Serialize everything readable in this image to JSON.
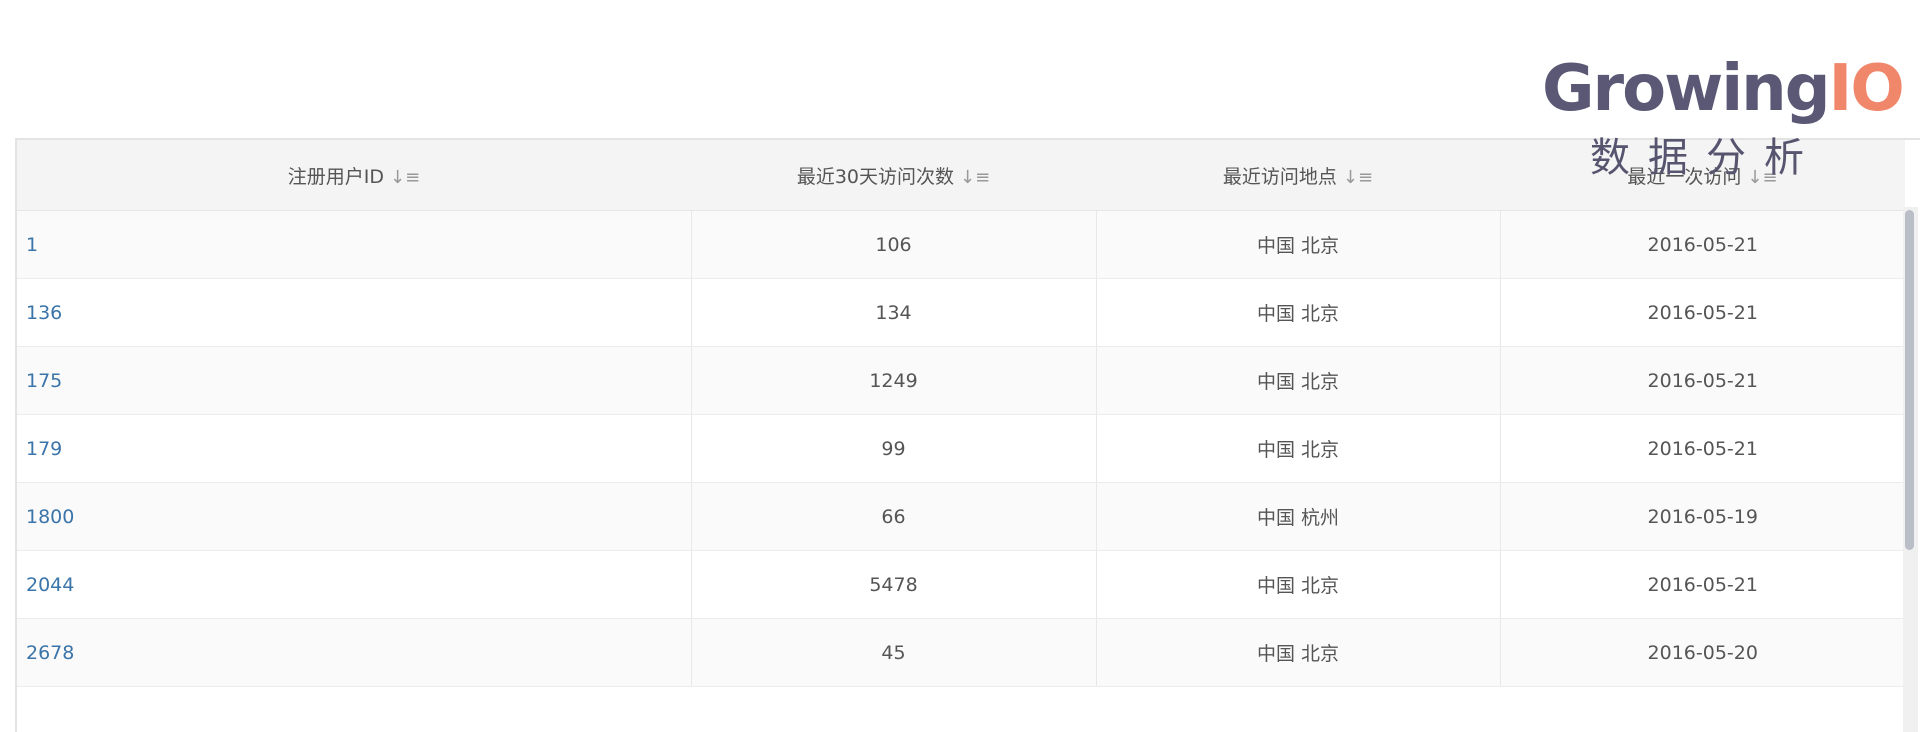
{
  "logo": {
    "word_main": "Growing",
    "word_accent": "IO",
    "subtitle": "数据分析",
    "colors": {
      "main": "#5a5874",
      "accent": "#f1876a"
    }
  },
  "table": {
    "columns": [
      {
        "label": "注册用户ID",
        "sort_icon": "sort-descending-icon"
      },
      {
        "label": "最近30天访问次数",
        "sort_icon": "sort-descending-icon"
      },
      {
        "label": "最近访问地点",
        "sort_icon": "sort-descending-icon"
      },
      {
        "label": "最近一次访问",
        "sort_icon": "sort-descending-icon"
      }
    ],
    "rows": [
      {
        "user_id": "1",
        "visits": "106",
        "location": "中国 北京",
        "last_visit": "2016-05-21"
      },
      {
        "user_id": "136",
        "visits": "134",
        "location": "中国 北京",
        "last_visit": "2016-05-21"
      },
      {
        "user_id": "175",
        "visits": "1249",
        "location": "中国 北京",
        "last_visit": "2016-05-21"
      },
      {
        "user_id": "179",
        "visits": "99",
        "location": "中国 北京",
        "last_visit": "2016-05-21"
      },
      {
        "user_id": "1800",
        "visits": "66",
        "location": "中国 杭州",
        "last_visit": "2016-05-19"
      },
      {
        "user_id": "2044",
        "visits": "5478",
        "location": "中国 北京",
        "last_visit": "2016-05-21"
      },
      {
        "user_id": "2678",
        "visits": "45",
        "location": "中国 北京",
        "last_visit": "2016-05-20"
      }
    ],
    "link_color": "#3b74a8"
  }
}
